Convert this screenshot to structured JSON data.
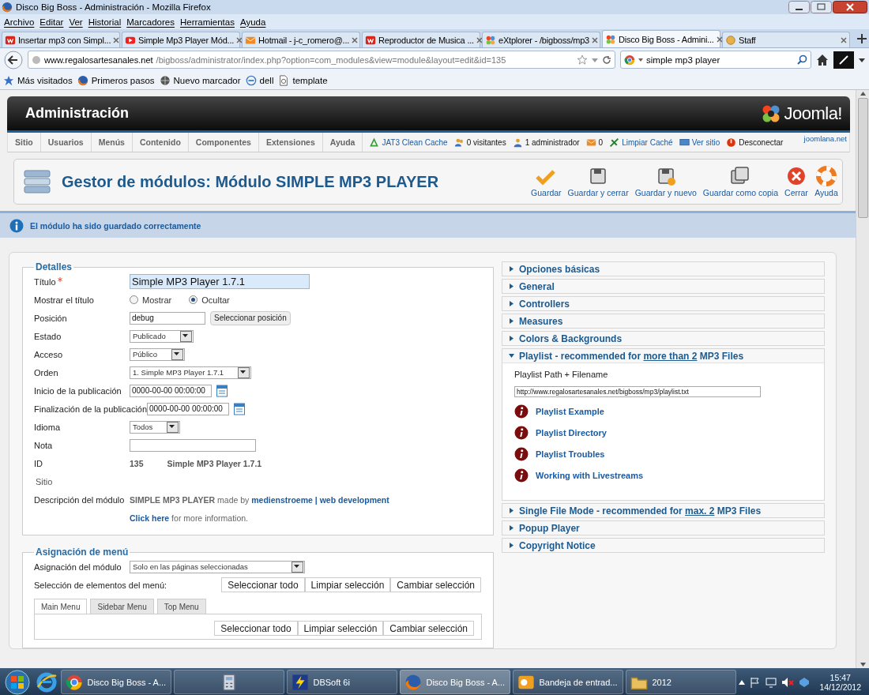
{
  "window": {
    "title": "Disco Big Boss - Administración - Mozilla Firefox"
  },
  "menu_bar": [
    "Archivo",
    "Editar",
    "Ver",
    "Historial",
    "Marcadores",
    "Herramientas",
    "Ayuda"
  ],
  "tabs": [
    {
      "label": "Insertar mp3 con Simpl...",
      "kind": "w",
      "selected": false
    },
    {
      "label": "Simple Mp3 Player Mód...",
      "kind": "video",
      "selected": false
    },
    {
      "label": "Hotmail - j-c_romero@...",
      "kind": "mail",
      "selected": false
    },
    {
      "label": "Reproductor de Musica ...",
      "kind": "w",
      "selected": false
    },
    {
      "label": "eXtplorer - /bigboss/mp3",
      "kind": "joomla",
      "selected": false
    },
    {
      "label": "Disco Big Boss - Admini...",
      "kind": "joomla",
      "selected": true
    },
    {
      "label": "Staff",
      "kind": "circle",
      "selected": false
    }
  ],
  "address_bar": {
    "host": "www.regalosartesanales.net",
    "path": "/bigboss/administrator/index.php?option=com_modules&view=module&layout=edit&id=135"
  },
  "search": {
    "value": "simple mp3  player"
  },
  "bookmarks": [
    {
      "label": "Más visitados",
      "kind": "star"
    },
    {
      "label": "Primeros pasos",
      "kind": "firefox"
    },
    {
      "label": "Nuevo marcador",
      "kind": "globe"
    },
    {
      "label": "dell",
      "kind": "dell"
    },
    {
      "label": "template",
      "kind": "page"
    }
  ],
  "admin": {
    "title": "Administración",
    "logo_text": "Joomla!",
    "nav": [
      "Sitio",
      "Usuarios",
      "Menús",
      "Contenido",
      "Componentes",
      "Extensiones",
      "Ayuda"
    ],
    "status": [
      {
        "label": "JAT3 Clean Cache",
        "kind": "cache",
        "link": true
      },
      {
        "label": "0 visitantes",
        "kind": "users",
        "link": false
      },
      {
        "label": "1 administrador",
        "kind": "user",
        "link": false
      },
      {
        "label": "0",
        "kind": "mail",
        "link": false
      },
      {
        "label": "Limpiar Caché",
        "kind": "broom",
        "link": true
      },
      {
        "label": "Ver sitio",
        "kind": "screen",
        "link": true
      },
      {
        "label": "Desconectar",
        "kind": "power",
        "link": false
      }
    ],
    "site_link": "joomlana.net",
    "toolbar": {
      "title": "Gestor de módulos: Módulo SIMPLE MP3 PLAYER",
      "buttons": [
        {
          "label": "Guardar",
          "kind": "check"
        },
        {
          "label": "Guardar y cerrar",
          "kind": "save"
        },
        {
          "label": "Guardar y nuevo",
          "kind": "save-new"
        },
        {
          "label": "Guardar como copia",
          "kind": "copy"
        },
        {
          "label": "Cerrar",
          "kind": "close"
        },
        {
          "label": "Ayuda",
          "kind": "help"
        }
      ]
    },
    "message": "El módulo ha sido guardado correctamente"
  },
  "details": {
    "legend": "Detalles",
    "fields": [
      {
        "kind": "text",
        "label": "Título",
        "required": true,
        "value": "Simple MP3 Player 1.7.1",
        "highlighted": true
      },
      {
        "kind": "radio",
        "label": "Mostrar el título",
        "options": [
          {
            "label": "Mostrar",
            "selected": false
          },
          {
            "label": "Ocultar",
            "selected": true
          }
        ]
      },
      {
        "kind": "text_button",
        "label": "Posición",
        "value": "debug",
        "button": "Seleccionar posición"
      },
      {
        "kind": "select",
        "label": "Estado",
        "value": "Publicado"
      },
      {
        "kind": "select",
        "label": "Acceso",
        "value": "Público"
      },
      {
        "kind": "select",
        "label": "Orden",
        "value": "1. Simple MP3 Player 1.7.1"
      },
      {
        "kind": "date",
        "label": "Inicio de la publicación",
        "value": "0000-00-00 00:00:00"
      },
      {
        "kind": "date",
        "label": "Finalización de la publicación",
        "value": "0000-00-00 00:00:00"
      },
      {
        "kind": "select",
        "label": "Idioma",
        "value": "Todos"
      },
      {
        "kind": "text",
        "label": "Nota"
      },
      {
        "kind": "static",
        "label": "ID",
        "value": "135",
        "extra": "Simple MP3 Player 1.7.1"
      },
      {
        "kind": "label",
        "label": "Sitio"
      },
      {
        "kind": "description",
        "label": "Descripción del módulo",
        "text": "**SIMPLE MP3 PLAYER** made by",
        "link": "medienstroeme | web development"
      },
      {
        "kind": "more",
        "link": "Click here",
        "text": "for more information."
      }
    ]
  },
  "options": {
    "panels": [
      {
        "title": "Opciones básicas",
        "expanded": false
      },
      {
        "title": "General",
        "expanded": false
      },
      {
        "title": "Controllers",
        "expanded": false
      },
      {
        "title": "Measures",
        "expanded": false
      },
      {
        "title": "Colors & Backgrounds",
        "expanded": false
      },
      {
        "title": "Playlist - recommended for",
        "link": "more than 2",
        "title_end": "MP3 Files",
        "expanded": true
      },
      {
        "title": "Single File Mode - recommended for",
        "link": "max. 2",
        "title_end": "MP3 Files",
        "expanded": false
      },
      {
        "title": "Popup Player",
        "expanded": false
      },
      {
        "title": "Copyright Notice",
        "expanded": false
      }
    ],
    "playlist": {
      "label": "Playlist Path + Filename",
      "value": "http://www.regalosartesanales.net/bigboss/mp3/playlist.txt",
      "links": [
        "Playlist Example",
        "Playlist Directory",
        "Playlist Troubles",
        "Working with Livestreams"
      ]
    }
  },
  "menu_assignment": {
    "legend": "Asignación de menú",
    "module_label": "Asignación del módulo",
    "select": "Solo en las páginas seleccionadas",
    "items_label": "Selección de elementos del menú:",
    "buttons": [
      "Seleccionar todo",
      "Limpiar selección",
      "Cambiar selección"
    ],
    "tabs": [
      {
        "label": "Main Menu",
        "selected": true
      },
      {
        "label": "Sidebar Menu",
        "selected": false
      },
      {
        "label": "Top Menu",
        "selected": false
      }
    ],
    "inner_buttons": [
      "Seleccionar todo",
      "Limpiar selección",
      "Cambiar selección"
    ]
  },
  "taskbar": {
    "items": [
      {
        "label": "Disco Big Boss - A...",
        "kind": "chrome",
        "selected": false
      },
      {
        "kind": "calculator",
        "selected": false
      },
      {
        "label": "DBSoft 6i",
        "kind": "app",
        "selected": false
      },
      {
        "label": "Disco Big Boss - A...",
        "kind": "firefox",
        "selected": true
      },
      {
        "label": "Bandeja de entrad...",
        "kind": "outlook",
        "selected": false
      },
      {
        "label": "2012",
        "kind": "folder",
        "selected": false
      }
    ],
    "time": "15:47",
    "date": "14/12/2012"
  }
}
